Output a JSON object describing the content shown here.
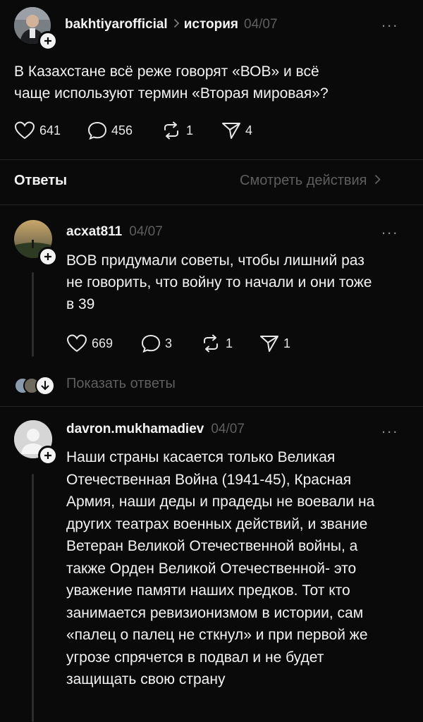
{
  "post": {
    "username": "bakhtiyarofficial",
    "topic": "история",
    "date": "04/07",
    "more": "...",
    "text_line1": "В Казахстане всё реже говорят «ВОВ» и всё",
    "text_line2": "чаще используют термин «Вторая мировая»?",
    "likes": "641",
    "comments": "456",
    "reposts": "1",
    "shares": "4"
  },
  "replies_header": {
    "title": "Ответы",
    "view_activity": "Смотреть действия"
  },
  "reply1": {
    "username": "acxat811",
    "date": "04/07",
    "more": "...",
    "lines": [
      "ВОВ придумали советы, чтобы лишний раз",
      "не говорить, что войну то начали и они тоже",
      "в 39"
    ],
    "likes": "669",
    "comments": "3",
    "reposts": "1",
    "shares": "1",
    "show_replies": "Показать ответы"
  },
  "reply2": {
    "username": "davron.mukhamadiev",
    "date": "04/07",
    "more": "...",
    "lines": [
      "Наши страны касается только Великая",
      "Отечественная Война (1941-45), Красная",
      "Армия, наши деды и прадеды не воевали на",
      "других театрах военных действий, и звание",
      "Ветеран Великой Отечественной войны, а",
      "также Орден Великой Отечественной- это",
      "уважение памяти наших предков. Тот кто",
      "занимается ревизионизмом в истории, сам",
      "«палец о палец не сткнул» и при первой же",
      "угрозе спрячется в подвал и не будет",
      "защищать свою страну"
    ]
  },
  "icons": {
    "like": "heart-icon",
    "comment": "comment-bubble-icon",
    "repost": "repost-icon",
    "share": "send-icon",
    "follow": "plus-icon",
    "chevron": "chevron-right-icon"
  },
  "colors": {
    "background": "#0a0a0a",
    "text": "#f3f3f3",
    "muted": "#5e5e5e"
  }
}
